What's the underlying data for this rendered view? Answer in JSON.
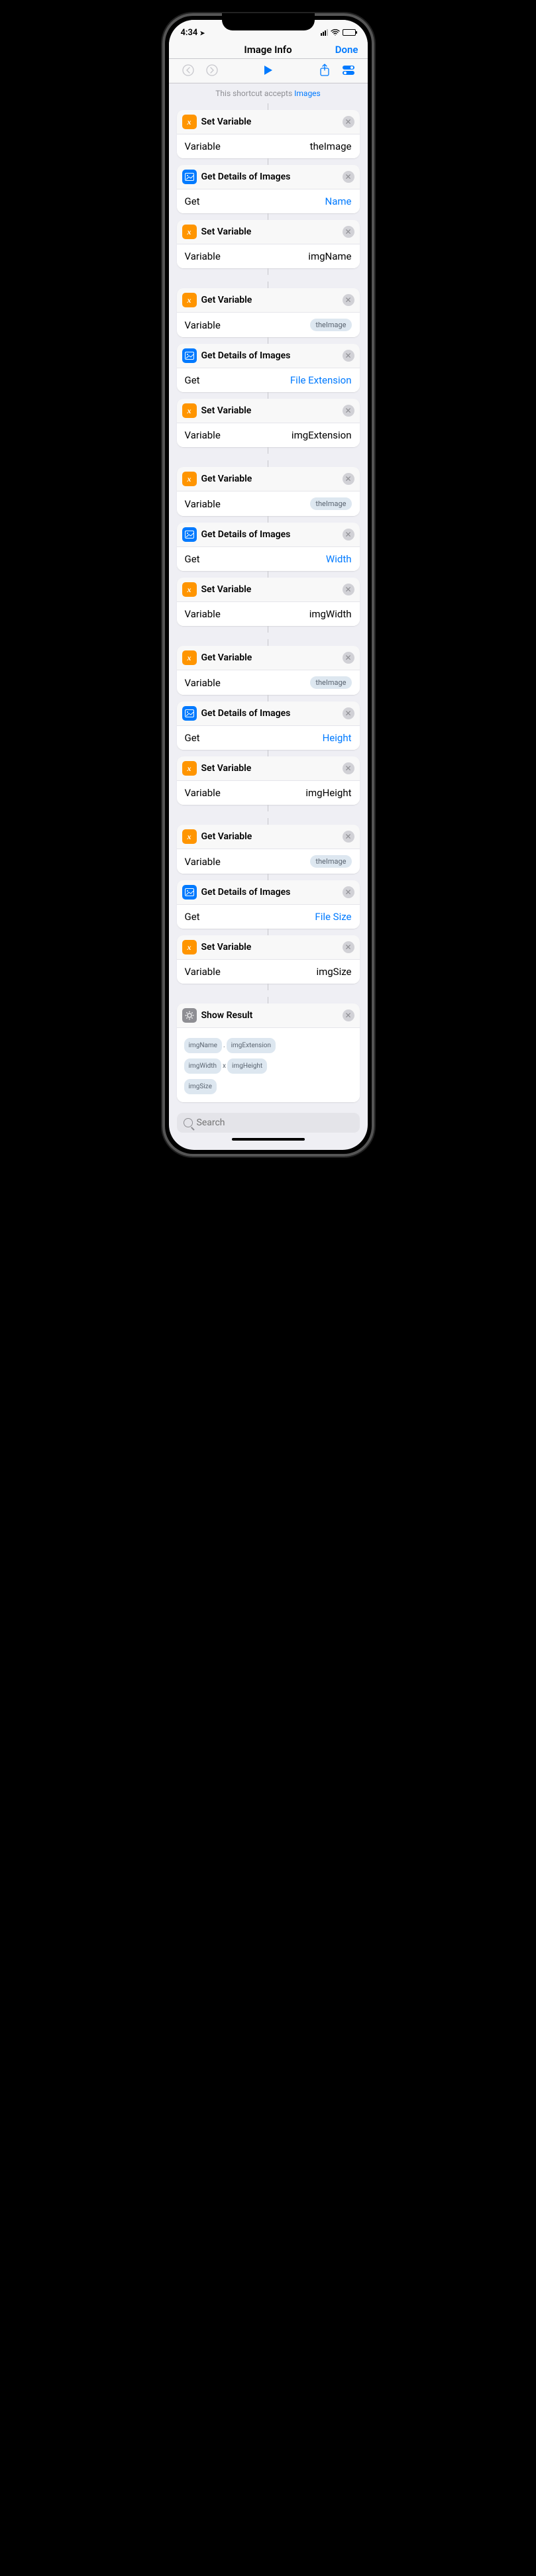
{
  "status": {
    "time": "4:34",
    "loc_glyph": "➤"
  },
  "nav": {
    "title": "Image Info",
    "done": "Done"
  },
  "accepts": {
    "prefix": "This shortcut accepts ",
    "link": "Images"
  },
  "actions": [
    {
      "kind": "var",
      "title": "Set Variable",
      "param_label": "Variable",
      "param_value": "theImage",
      "value_style": "plain"
    },
    {
      "kind": "img",
      "title": "Get Details of Images",
      "param_label": "Get",
      "param_value": "Name",
      "value_style": "link"
    },
    {
      "kind": "var",
      "title": "Set Variable",
      "param_label": "Variable",
      "param_value": "imgName",
      "value_style": "plain"
    },
    {
      "kind": "var",
      "title": "Get Variable",
      "param_label": "Variable",
      "param_value": "theImage",
      "value_style": "token"
    },
    {
      "kind": "img",
      "title": "Get Details of Images",
      "param_label": "Get",
      "param_value": "File Extension",
      "value_style": "link"
    },
    {
      "kind": "var",
      "title": "Set Variable",
      "param_label": "Variable",
      "param_value": "imgExtension",
      "value_style": "plain"
    },
    {
      "kind": "var",
      "title": "Get Variable",
      "param_label": "Variable",
      "param_value": "theImage",
      "value_style": "token"
    },
    {
      "kind": "img",
      "title": "Get Details of Images",
      "param_label": "Get",
      "param_value": "Width",
      "value_style": "link"
    },
    {
      "kind": "var",
      "title": "Set Variable",
      "param_label": "Variable",
      "param_value": "imgWidth",
      "value_style": "plain"
    },
    {
      "kind": "var",
      "title": "Get Variable",
      "param_label": "Variable",
      "param_value": "theImage",
      "value_style": "token"
    },
    {
      "kind": "img",
      "title": "Get Details of Images",
      "param_label": "Get",
      "param_value": "Height",
      "value_style": "link"
    },
    {
      "kind": "var",
      "title": "Set Variable",
      "param_label": "Variable",
      "param_value": "imgHeight",
      "value_style": "plain"
    },
    {
      "kind": "var",
      "title": "Get Variable",
      "param_label": "Variable",
      "param_value": "theImage",
      "value_style": "token"
    },
    {
      "kind": "img",
      "title": "Get Details of Images",
      "param_label": "Get",
      "param_value": "File Size",
      "value_style": "link"
    },
    {
      "kind": "var",
      "title": "Set Variable",
      "param_label": "Variable",
      "param_value": "imgSize",
      "value_style": "plain"
    }
  ],
  "gaps_after": [
    2,
    5,
    8,
    11,
    14
  ],
  "result": {
    "title": "Show Result",
    "line1": {
      "a": "imgName",
      "sep": ".",
      "b": "imgExtension"
    },
    "line2": {
      "a": "imgWidth",
      "sep": "x",
      "b": "imgHeight"
    },
    "line3": {
      "a": "imgSize"
    }
  },
  "search": {
    "placeholder": "Search"
  },
  "icons": {
    "var_glyph": "x",
    "img_alt": "picture",
    "res_alt": "gear"
  }
}
